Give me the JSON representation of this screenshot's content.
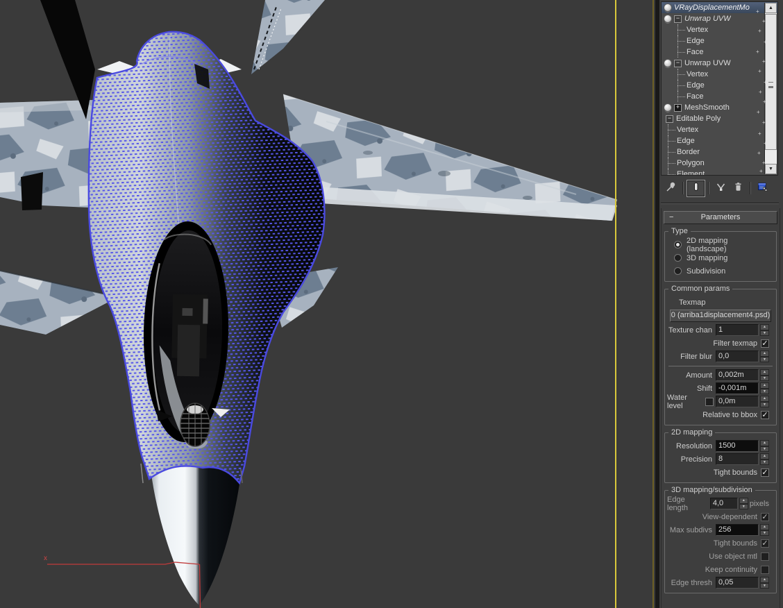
{
  "viewport": {
    "axis_label": "x",
    "active_border_color": "#d9c83b",
    "cage_color": "#5656ea"
  },
  "modifier_stack": {
    "items": [
      {
        "label": "VRayDisplacementMo",
        "indent": 0,
        "bulb": true,
        "italic": true,
        "selected": true
      },
      {
        "label": "Unwrap UVW",
        "indent": 0,
        "bulb": true,
        "italic": true,
        "toggle": "minus"
      },
      {
        "label": "Vertex",
        "indent": 1
      },
      {
        "label": "Edge",
        "indent": 1
      },
      {
        "label": "Face",
        "indent": 1
      },
      {
        "label": "Unwrap UVW",
        "indent": 0,
        "bulb": true,
        "toggle": "minus"
      },
      {
        "label": "Vertex",
        "indent": 1
      },
      {
        "label": "Edge",
        "indent": 1
      },
      {
        "label": "Face",
        "indent": 1
      },
      {
        "label": "MeshSmooth",
        "indent": 0,
        "bulb": true,
        "toggle": "plus"
      },
      {
        "label": "Editable Poly",
        "indent": 0,
        "toggle": "minus"
      },
      {
        "label": "Vertex",
        "indent": 1
      },
      {
        "label": "Edge",
        "indent": 1
      },
      {
        "label": "Border",
        "indent": 1
      },
      {
        "label": "Polygon",
        "indent": 1
      },
      {
        "label": "Element",
        "indent": 1
      }
    ]
  },
  "stack_toolbar": {
    "buttons": [
      {
        "name": "pin-stack"
      },
      {
        "name": "show-end-result",
        "active": true
      },
      {
        "name": "make-unique"
      },
      {
        "name": "remove-modifier"
      },
      {
        "name": "configure-modifier-sets"
      }
    ]
  },
  "rollout": {
    "title": "Parameters"
  },
  "parameters": {
    "groups": [
      {
        "title": "Type",
        "rows": [
          {
            "kind": "radio",
            "label": "2D mapping (landscape)",
            "checked": true
          },
          {
            "kind": "radio",
            "label": "3D mapping",
            "checked": false
          },
          {
            "kind": "radio",
            "label": "Subdivision",
            "checked": false
          }
        ]
      },
      {
        "title": "Common params",
        "rows": [
          {
            "kind": "label",
            "label": "Texmap"
          },
          {
            "kind": "button",
            "label": "0 (arriba1displacement4.psd)"
          },
          {
            "kind": "spin",
            "label": "Texture chan",
            "value": "1"
          },
          {
            "kind": "check",
            "label": "Filter texmap",
            "checked": true
          },
          {
            "kind": "spin",
            "label": "Filter blur",
            "value": "0,0"
          },
          {
            "kind": "divider"
          },
          {
            "kind": "spin",
            "label": "Amount",
            "value": "0,002m"
          },
          {
            "kind": "spin",
            "label": "Shift",
            "value": "-0,001m",
            "dark": true
          },
          {
            "kind": "spin",
            "label": "Water level",
            "value": "0,0m",
            "precheck": true,
            "prechecked": false
          },
          {
            "kind": "check",
            "label": "Relative to bbox",
            "checked": true
          }
        ]
      },
      {
        "title": "2D mapping",
        "rows": [
          {
            "kind": "spin",
            "label": "Resolution",
            "value": "1500",
            "dark": true
          },
          {
            "kind": "spin",
            "label": "Precision",
            "value": "8"
          },
          {
            "kind": "check",
            "label": "Tight bounds",
            "checked": true
          }
        ]
      },
      {
        "title": "3D mapping/subdivision",
        "dim": true,
        "rows": [
          {
            "kind": "spin",
            "label": "Edge length",
            "value": "4,0",
            "suffix": "pixels",
            "small": true
          },
          {
            "kind": "check",
            "label": "View-dependent",
            "checked": true
          },
          {
            "kind": "spin",
            "label": "Max subdivs",
            "value": "256",
            "dark": true
          },
          {
            "kind": "check",
            "label": "Tight bounds",
            "checked": true
          },
          {
            "kind": "check",
            "label": "Use object mtl",
            "checked": false
          },
          {
            "kind": "check",
            "label": "Keep continuity",
            "checked": false
          },
          {
            "kind": "spin",
            "label": "Edge thresh",
            "value": "0,05"
          }
        ]
      }
    ]
  }
}
